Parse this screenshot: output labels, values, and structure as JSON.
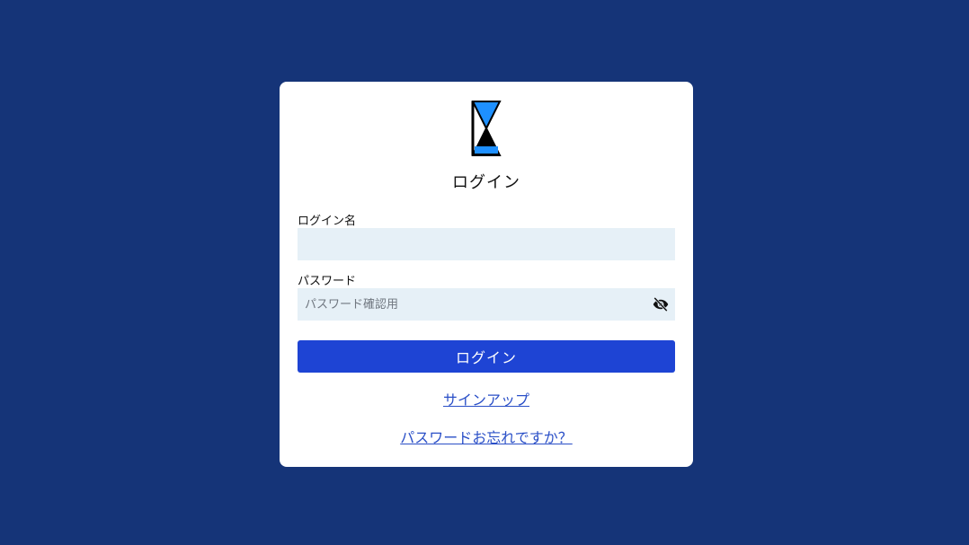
{
  "colors": {
    "background": "#153478",
    "card": "#ffffff",
    "input_bg": "#e6f0f7",
    "primary_button": "#1e44d4",
    "link": "#2a4fc7",
    "logo_accent": "#1e90ff"
  },
  "logo": {
    "icon": "hourglass-logo-icon"
  },
  "title": "ログイン",
  "form": {
    "login_name_label": "ログイン名",
    "login_name_value": "",
    "login_name_placeholder": "",
    "password_label": "パスワード",
    "password_value": "",
    "password_placeholder": "パスワード確認用",
    "toggle_icon": "eye-off-icon"
  },
  "submit_label": "ログイン",
  "links": {
    "signup": "サインアップ",
    "forgot_password": "パスワードお忘れですか？"
  }
}
